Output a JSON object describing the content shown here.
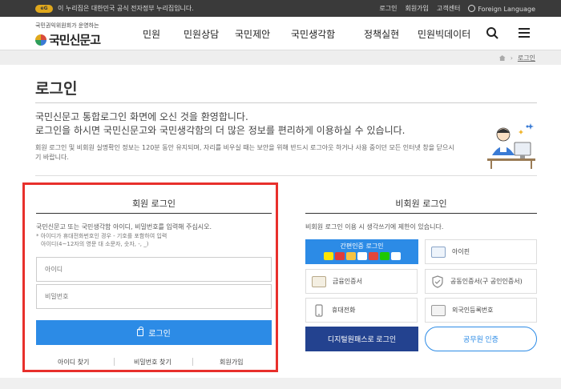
{
  "topbar": {
    "gov_logo": "eG",
    "gov_notice": "이 누리집은 대한민국 공식 전자정부 누리집입니다.",
    "links": [
      "로그인",
      "회원가입",
      "고객센터"
    ],
    "language": "Foreign Language"
  },
  "header": {
    "logo_subtitle": "국민권익위원회가 운영하는",
    "logo_title": "국민신문고",
    "nav": [
      "민원",
      "민원상담",
      "국민제안",
      "국민생각함",
      "정책실현",
      "민원빅데이터"
    ],
    "search_icon": "search-icon",
    "menu_icon": "hamburger-menu-icon"
  },
  "breadcrumb": {
    "current": "로그인"
  },
  "page": {
    "title": "로그인",
    "welcome_line1": "국민신문고 통합로그인 화면에 오신 것을 환영합니다.",
    "welcome_line2": "로그인을 하시면 국민신문고와 국민생각함의 더 많은 정보를 편리하게 이용하실 수 있습니다.",
    "notice_line1": "회원 로그인 및 비회원 실명확인 정보는 120분 동안 유지되며, 자리를 비우실 때는 보안을 위해 반드시 로그아웃 하거나 사용 중이던 모든 인터넷 창을 닫으시",
    "notice_line2": "기 바랍니다."
  },
  "member": {
    "title": "회원 로그인",
    "desc": "국민신문고 또는 국민생각함 아이디, 비밀번호를 입력해 주십시오.",
    "hint1": "* 아이디가 휴대전화번호인 경우 - 기호를 포함하여 입력",
    "hint2": "아이디(4~12자의 영문 대 소문자, 숫자, -, _)",
    "id_placeholder": "아이디",
    "pw_placeholder": "비밀번호",
    "login_button": "로그인",
    "find_id": "아이디 찾기",
    "find_pw": "비밀번호 찾기",
    "join": "회원가입"
  },
  "nonmember": {
    "title": "비회원 로그인",
    "desc": "비회원 로그인 이용 시 생각쓰기에 제한이 있습니다.",
    "easy_auth": "간편인증 로그인",
    "ipin": "아이핀",
    "financial_cert": "금융인증서",
    "joint_cert": "공동인증서(구 공인인증서)",
    "mobile": "휴대전화",
    "alien_reg": "외국인등록번호",
    "digital_pass": "디지털원패스로 로그인",
    "official_auth": "공무원 인증"
  },
  "colors": {
    "accent_blue": "#2c8be6",
    "navy": "#23428f",
    "highlight_red": "#e8302c",
    "topbar_bg": "#3a3a3a"
  }
}
